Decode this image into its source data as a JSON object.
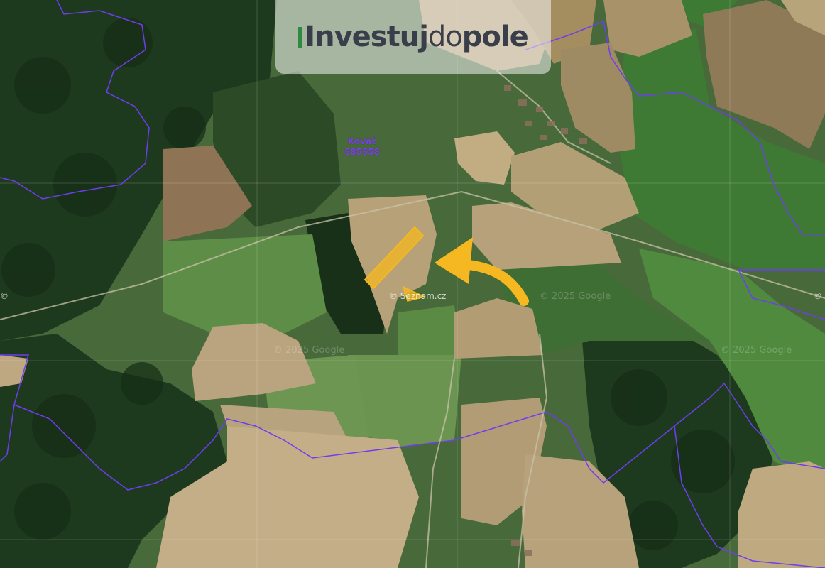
{
  "logo": {
    "prefix": "Investuj",
    "middle": "do",
    "suffix": "pole"
  },
  "cadastre": {
    "name": "Kovač",
    "code": "685658"
  },
  "watermarks": [
    "© 2025 Google",
    "© 2025 Google",
    "© 2025 Google"
  ],
  "copyright_marks": [
    "© Seznam.cz",
    "©",
    "©"
  ],
  "colors": {
    "parcel": "#f5b820",
    "arrow": "#f5b820",
    "boundary": "#6f3df0",
    "field_brown": "#9c8a5f",
    "field_green": "#5b7f3b",
    "forest": "#203a1f"
  },
  "icons": {
    "arrow": "curved-arrow-icon",
    "parcel": "parcel-highlight"
  }
}
